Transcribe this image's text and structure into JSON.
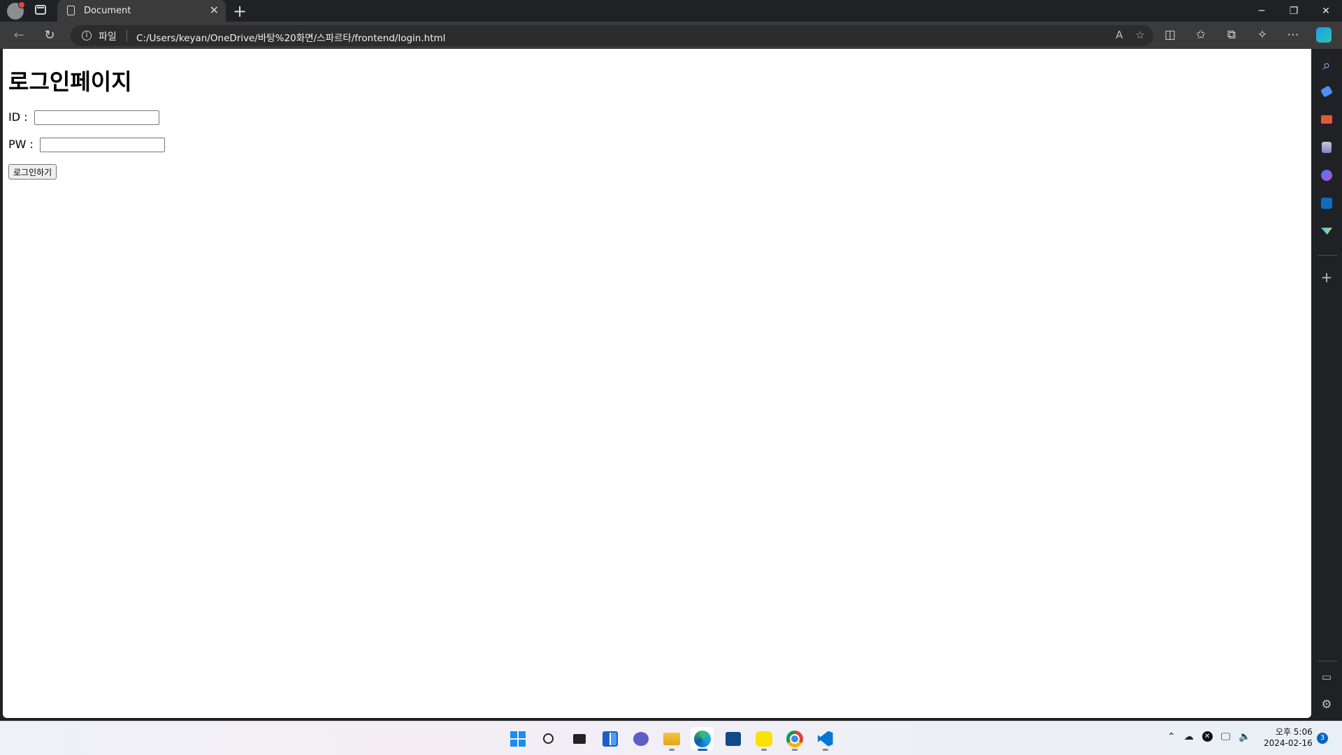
{
  "tab": {
    "title": "Document",
    "close": "✕",
    "new": "+"
  },
  "window": {
    "minimize": "─",
    "restore": "❐",
    "close": "✕"
  },
  "address": {
    "info": "i",
    "scheme_label": "파일",
    "url": "C:/Users/keyan/OneDrive/바탕%20화면/스파르타/frontend/login.html"
  },
  "page": {
    "heading": "로그인페이지",
    "id_label": "ID :",
    "pw_label": "PW :",
    "id_value": "",
    "pw_value": "",
    "login_button": "로그인하기"
  },
  "taskbar": {
    "clock_time": "오후 5:06",
    "clock_date": "2024-02-16",
    "notification_count": "3"
  },
  "icons": {
    "back": "←",
    "reload": "↻",
    "read_aloud": "A",
    "favorite": "☆",
    "split": "◫",
    "favorites": "✩",
    "collections": "⧉",
    "extensions": "✧",
    "more": "⋯",
    "search": "⌕",
    "sidebar_add": "+",
    "sidebar_panel": "▭",
    "settings": "⚙"
  },
  "colors": {
    "accent_blue": "#0067c0",
    "edge_copilot": "#1a9cf0",
    "vscode_blue": "#0078d4",
    "kakao_yellow": "#fae100"
  }
}
